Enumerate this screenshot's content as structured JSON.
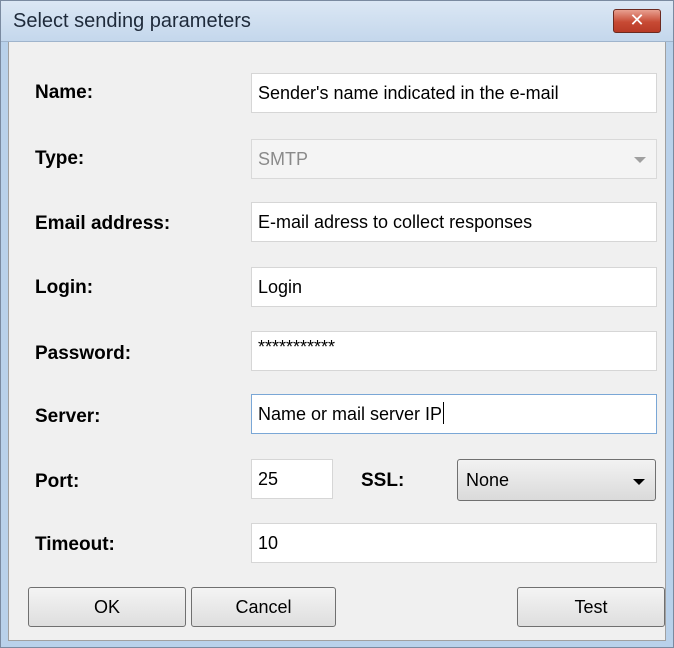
{
  "window": {
    "title": "Select sending parameters",
    "close_glyph": "✕"
  },
  "form": {
    "name": {
      "label": "Name:",
      "value": "Sender's name indicated in the e-mail"
    },
    "type": {
      "label": "Type:",
      "value": "SMTP"
    },
    "email": {
      "label": "Email address:",
      "value": "E-mail adress to collect responses"
    },
    "login": {
      "label": "Login:",
      "value": "Login"
    },
    "password": {
      "label": "Password:",
      "value": "***********"
    },
    "server": {
      "label": "Server:",
      "value": "Name or mail server IP"
    },
    "port": {
      "label": "Port:",
      "value": "25"
    },
    "ssl": {
      "label": "SSL:",
      "value": "None"
    },
    "timeout": {
      "label": "Timeout:",
      "value": "10"
    }
  },
  "buttons": {
    "ok": "OK",
    "cancel": "Cancel",
    "test": "Test"
  }
}
